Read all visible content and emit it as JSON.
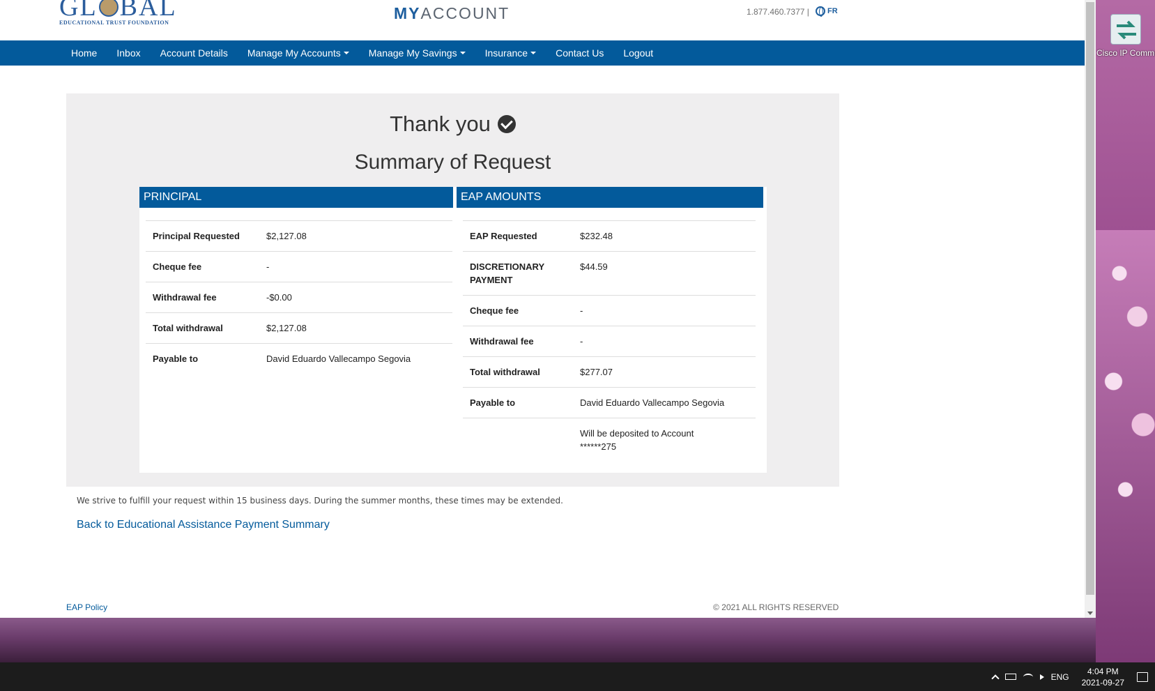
{
  "desktop": {
    "icon_label": "Cisco IP Communic..."
  },
  "header": {
    "logo_word_left": "GL",
    "logo_word_right": "BAL",
    "logo_sub": "EDUCATIONAL TRUST FOUNDATION",
    "my": "MY",
    "account": "ACCOUNT",
    "phone": "1.877.460.7377 |",
    "lang": "FR"
  },
  "nav": {
    "items": [
      {
        "label": "Home",
        "dropdown": false
      },
      {
        "label": "Inbox",
        "dropdown": false
      },
      {
        "label": "Account Details",
        "dropdown": false
      },
      {
        "label": "Manage My Accounts",
        "dropdown": true
      },
      {
        "label": "Manage My Savings",
        "dropdown": true
      },
      {
        "label": "Insurance",
        "dropdown": true
      },
      {
        "label": "Contact Us",
        "dropdown": false
      },
      {
        "label": "Logout",
        "dropdown": false
      }
    ]
  },
  "main": {
    "thanks": "Thank you",
    "summary_title": "Summary of Request",
    "principal": {
      "heading": "PRINCIPAL",
      "rows": [
        {
          "label": "Principal Requested",
          "value": "$2,127.08"
        },
        {
          "label": "Cheque fee",
          "value": "-"
        },
        {
          "label": "Withdrawal fee",
          "value": "-$0.00"
        },
        {
          "label": "Total withdrawal",
          "value": "$2,127.08"
        },
        {
          "label": "Payable to",
          "value": "David Eduardo Vallecampo Segovia"
        }
      ]
    },
    "eap": {
      "heading": "EAP AMOUNTS",
      "rows": [
        {
          "label": "EAP Requested",
          "value": "$232.48"
        },
        {
          "label": "DISCRETIONARY PAYMENT",
          "value": "$44.59"
        },
        {
          "label": "Cheque fee",
          "value": "-"
        },
        {
          "label": "Withdrawal fee",
          "value": "-"
        },
        {
          "label": "Total withdrawal",
          "value": "$277.07"
        },
        {
          "label": "Payable to",
          "value": "David Eduardo Vallecampo Segovia"
        },
        {
          "label": "",
          "value": "Will be deposited to Account ******275"
        }
      ]
    },
    "fulfill_note": "We strive to fulfill your request within 15 business days. During the summer months, these times may be extended.",
    "back_link": "Back to Educational Assistance Payment Summary"
  },
  "footer": {
    "policy": "EAP Policy",
    "rights": "© 2021 ALL RIGHTS RESERVED"
  },
  "taskbar": {
    "lang": "ENG",
    "time": "4:04 PM",
    "date": "2021-09-27"
  }
}
